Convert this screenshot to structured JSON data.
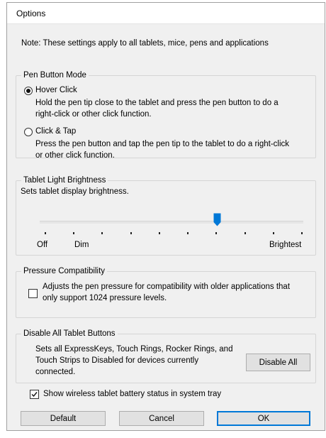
{
  "window": {
    "title": "Options"
  },
  "note": "Note: These settings apply to all tablets, mice, pens and applications",
  "pen_button_mode": {
    "legend": "Pen Button Mode",
    "options": [
      {
        "label": "Hover Click",
        "selected": true,
        "description": [
          "Hold the pen tip close to the tablet and press the pen button to do a",
          "right-click or other click function."
        ]
      },
      {
        "label": "Click & Tap",
        "selected": false,
        "description": [
          "Press the pen button and tap the pen tip to the tablet to do a right-click",
          "or other click function."
        ]
      }
    ]
  },
  "brightness": {
    "legend": "Tablet Light Brightness",
    "description": "Sets tablet display brightness.",
    "min_label": "Off",
    "low_label": "Dim",
    "max_label": "Brightest",
    "tick_count": 10,
    "level_fraction": 0.67,
    "thumb_color": "#0078d7"
  },
  "pressure": {
    "legend": "Pressure Compatibility",
    "checked": false,
    "description": [
      "Adjusts the pen pressure for compatibility with older applications that",
      "only support 1024 pressure levels."
    ]
  },
  "disable_buttons": {
    "legend": "Disable All Tablet Buttons",
    "description": [
      "Sets all ExpressKeys, Touch Rings, Rocker Rings, and",
      "Touch Strips to Disabled for devices currently",
      "connected."
    ],
    "button_label": "Disable All"
  },
  "battery_status": {
    "label": "Show wireless tablet battery status in system tray",
    "checked": true
  },
  "footer": {
    "default_label": "Default",
    "cancel_label": "Cancel",
    "ok_label": "OK"
  },
  "colors": {
    "dialog_bg": "#f0f0f0",
    "accent": "#0078d7",
    "button_bg": "#e1e1e1"
  }
}
